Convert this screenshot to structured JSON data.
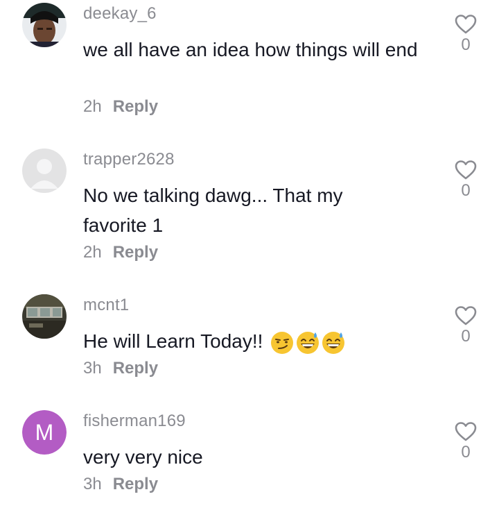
{
  "comments": [
    {
      "username": "deekay_6",
      "text": "we all have an idea how things will end",
      "time": "2h",
      "reply_label": "Reply",
      "likes": "0",
      "avatar": {
        "type": "photo",
        "icon": "profile-photo"
      }
    },
    {
      "username": "trapper2628",
      "text": "No we talking dawg... That my favorite 1",
      "time": "2h",
      "reply_label": "Reply",
      "likes": "0",
      "avatar": {
        "type": "placeholder",
        "icon": "default-avatar",
        "color": "#e3e3e4"
      }
    },
    {
      "username": "mcnt1",
      "text": "He will Learn Today!!",
      "emojis": [
        "smirking-face",
        "grinning-face-with-sweat",
        "grinning-face-with-sweat"
      ],
      "time": "3h",
      "reply_label": "Reply",
      "likes": "0",
      "avatar": {
        "type": "photo",
        "icon": "profile-photo"
      }
    },
    {
      "username": "fisherman169",
      "text": "very very nice",
      "time": "3h",
      "reply_label": "Reply",
      "likes": "0",
      "avatar": {
        "type": "letter",
        "letter": "M",
        "color": "#b35cc4"
      }
    }
  ],
  "colors": {
    "text": "#161823",
    "secondary": "#8a8b91",
    "heart": "#8a8b91"
  }
}
